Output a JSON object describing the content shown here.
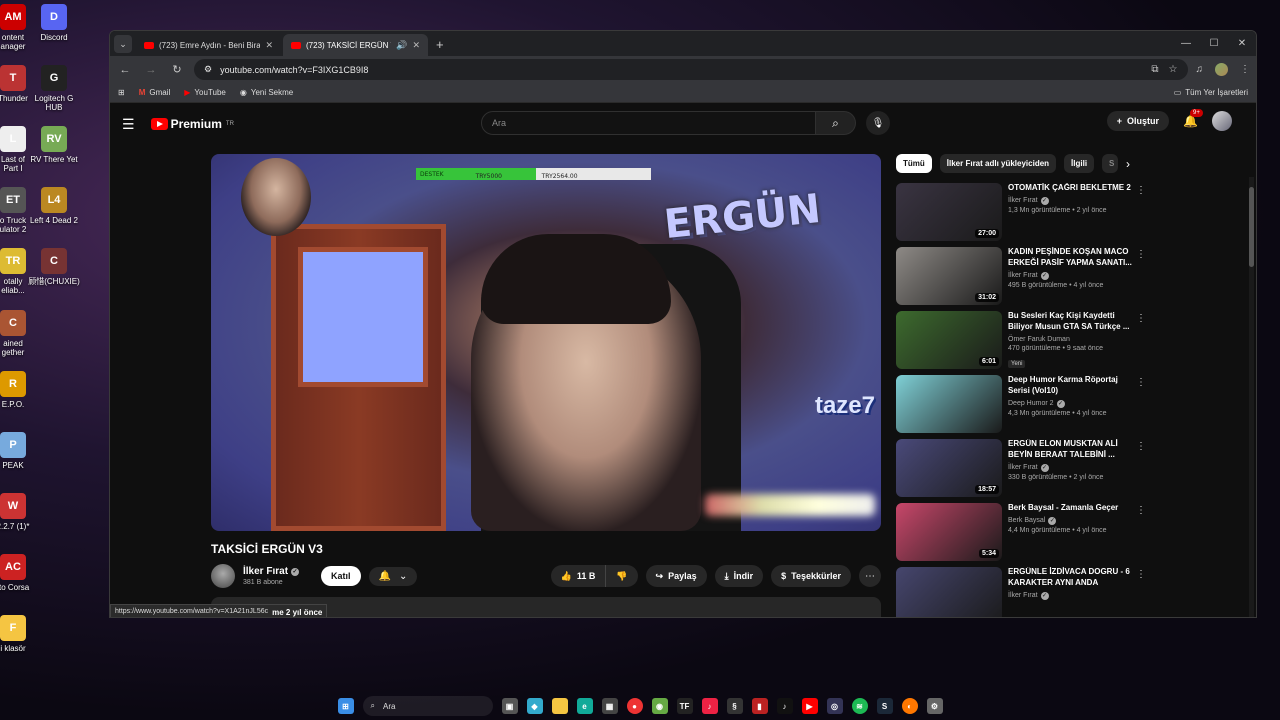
{
  "desktop": {
    "icons": [
      {
        "label": "ontent\nanager",
        "short": "AM",
        "color": "#c00"
      },
      {
        "label": "Discord",
        "short": "D",
        "color": "#5865f2"
      },
      {
        "label": "Thunder",
        "short": "T",
        "color": "#b33"
      },
      {
        "label": "Logitech G\nHUB",
        "short": "G",
        "color": "#222"
      },
      {
        "label": "Last of\nPart I",
        "short": "L",
        "color": "#eee"
      },
      {
        "label": "RV There Yet",
        "short": "RV",
        "color": "#7a5"
      },
      {
        "label": "o Truck\nulator 2",
        "short": "ET",
        "color": "#555"
      },
      {
        "label": "Left 4 Dead 2",
        "short": "L4",
        "color": "#b82"
      },
      {
        "label": "otally\neliab...",
        "short": "TR",
        "color": "#db3"
      },
      {
        "label": "顾惜(CHUXIE)",
        "short": "C",
        "color": "#733"
      },
      {
        "label": "ained\ngether",
        "short": "C",
        "color": "#a53"
      },
      {
        "label": "E.P.O.",
        "short": "R",
        "color": "#d90"
      },
      {
        "label": "PEAK",
        "short": "P",
        "color": "#7ad"
      },
      {
        "label": "2.2.7 (1)*",
        "short": "W",
        "color": "#c33"
      },
      {
        "label": "tto Corsa",
        "short": "AC",
        "color": "#c22"
      },
      {
        "label": "i klasör",
        "short": "F",
        "color": "#f5c542"
      }
    ]
  },
  "browser": {
    "tabs": [
      {
        "title": "(723) Emre Aydın - Beni Biraz B"
      },
      {
        "title": "(723) TAKSİCİ ERGÜN V3 -"
      }
    ],
    "url": "youtube.com/watch?v=F3IXG1CB9I8",
    "bookmarks": [
      "Gmail",
      "YouTube",
      "Yeni Sekme"
    ],
    "all_bookmarks": "Tüm Yer İşaretleri"
  },
  "youtube": {
    "logo_text": "Premium",
    "logo_sup": "TR",
    "search_placeholder": "Ara",
    "create_label": "Oluştur",
    "notif_badge": "9+",
    "overlay": {
      "label": "DESTEK",
      "current": "TRY2564.00",
      "target": "TRY5000",
      "progress": 0.51,
      "wall_sign": "ERGÜN",
      "taze_sign": "taze7"
    },
    "video": {
      "title": "TAKSİCİ ERGÜN V3",
      "channel": "İlker Fırat",
      "subscribers": "381 B abone",
      "join_label": "Katıl",
      "likes": "11 B",
      "share_label": "Paylaş",
      "download_label": "İndir",
      "thanks_label": "Teşekkürler"
    },
    "status_url": "https://www.youtube.com/watch?v=X1A21nJL56c",
    "status_tail": "me  2 yıl önce",
    "chips": [
      "Tümü",
      "İlker Fırat adlı yükleyiciden",
      "İlgili",
      "S"
    ],
    "recommendations": [
      {
        "title": "OTOMATİK ÇAĞRI BEKLETME 2",
        "channel": "İlker Fırat",
        "verified": true,
        "stats": "1,3 Mn görüntüleme • 2 yıl önce",
        "duration": "27:00",
        "thumb": "#3a3442",
        "badge": ""
      },
      {
        "title": "KADIN PEŞİNDE KOŞAN MACO ERKEĞİ PASİF YAPMA SANATI...",
        "channel": "İlker Fırat",
        "verified": true,
        "stats": "495 B görüntüleme • 4 yıl önce",
        "duration": "31:02",
        "thumb": "#8e8a86",
        "badge": ""
      },
      {
        "title": "Bu Sesleri Kaç Kişi Kaydetti Biliyor Musun GTA SA Türkçe ...",
        "channel": "Ömer Faruk Duman",
        "verified": false,
        "stats": "470 görüntüleme • 9 saat önce",
        "duration": "6:01",
        "thumb": "#3d6b2e",
        "badge": "Yeni"
      },
      {
        "title": "Deep Humor Karma Röportaj Serisi (Vol10)",
        "channel": "Deep Humor 2",
        "verified": true,
        "stats": "4,3 Mn görüntüleme • 4 yıl önce",
        "duration": "",
        "thumb": "#7fd0d6",
        "badge": ""
      },
      {
        "title": "ERGÜN ELON MUSKTAN ALİ BEYİN BERAAT TALEBİNİ ...",
        "channel": "İlker Fırat",
        "verified": true,
        "stats": "330 B görüntüleme • 2 yıl önce",
        "duration": "18:57",
        "thumb": "#4a4a7a",
        "badge": ""
      },
      {
        "title": "Berk Baysal - Zamanla Geçer",
        "channel": "Berk Baysal",
        "verified": true,
        "stats": "4,4 Mn görüntüleme • 4 yıl önce",
        "duration": "5:34",
        "thumb": "#c8476a",
        "badge": ""
      },
      {
        "title": "ERGÜNLE İZDİVACA DOGRU - 6 KARAKTER AYNI ANDA",
        "channel": "İlker Fırat",
        "verified": true,
        "stats": "",
        "duration": "",
        "thumb": "#46466e",
        "badge": ""
      }
    ]
  },
  "taskbar": {
    "search_label": "Ara"
  }
}
